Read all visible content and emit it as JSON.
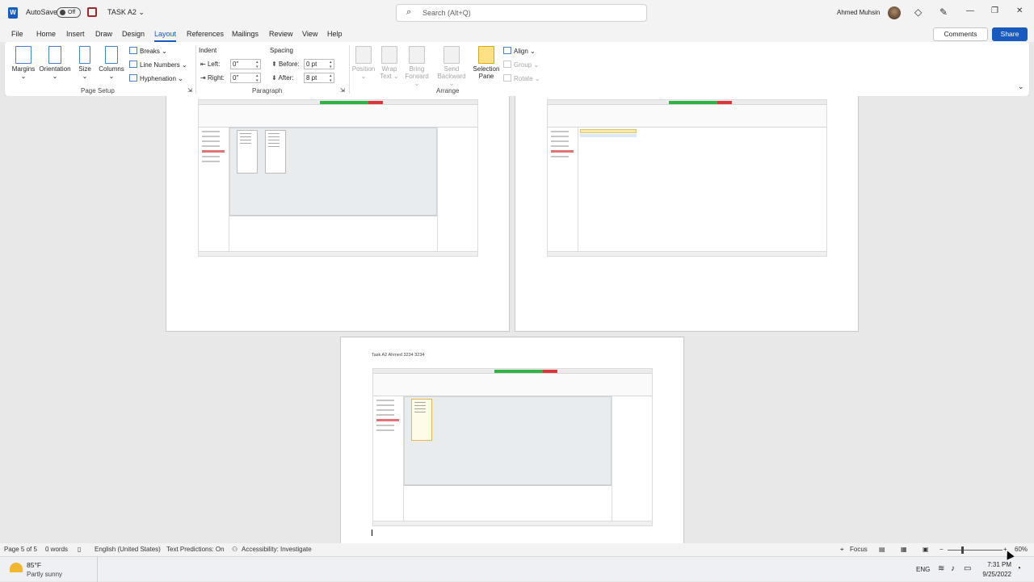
{
  "titlebar": {
    "app_logo": "W",
    "autosave_label": "AutoSave",
    "autosave_state": "Off",
    "doc_title": "TASK A2",
    "doc_title_chevron": "⌄",
    "search_placeholder": "Search (Alt+Q)",
    "user_name": "Ahmed Muhsin",
    "icons": [
      "diamond-icon",
      "pen-icon",
      "minimize-icon",
      "restore-icon",
      "close-icon"
    ],
    "glyphs": {
      "diamond": "◇",
      "pen": "✎",
      "minimize": "—",
      "restore": "❐",
      "close": "✕",
      "search": "⌕"
    }
  },
  "menu": {
    "tabs": [
      "File",
      "Home",
      "Insert",
      "Draw",
      "Design",
      "Layout",
      "References",
      "Mailings",
      "Review",
      "View",
      "Help"
    ],
    "active_tab": "Layout",
    "comments_label": "Comments",
    "share_label": "Share"
  },
  "ribbon": {
    "page_setup": {
      "margins": "Margins",
      "orientation": "Orientation",
      "size": "Size",
      "columns": "Columns",
      "breaks": "Breaks",
      "line_numbers": "Line Numbers",
      "hyphenation": "Hyphenation",
      "label": "Page Setup"
    },
    "paragraph": {
      "indent_title": "Indent",
      "left_label": "Left:",
      "left_value": "0\"",
      "right_label": "Right:",
      "right_value": "0\"",
      "spacing_title": "Spacing",
      "before_label": "Before:",
      "before_value": "0 pt",
      "after_label": "After:",
      "after_value": "8 pt",
      "label": "Paragraph"
    },
    "arrange": {
      "position": "Position",
      "wrap_text_1": "Wrap",
      "wrap_text_2": "Text",
      "bring_forward_1": "Bring",
      "bring_forward_2": "Forward",
      "send_backward_1": "Send",
      "send_backward_2": "Backward",
      "selection_pane_1": "Selection",
      "selection_pane_2": "Pane",
      "align": "Align",
      "group": "Group",
      "rotate": "Rotate",
      "label": "Arrange"
    }
  },
  "document": {
    "page3_caption": "Task A2 Ahmed 3234 3234"
  },
  "statusbar": {
    "page": "Page 5 of 5",
    "words": "0 words",
    "language": "English (United States)",
    "text_predictions": "Text Predictions: On",
    "accessibility": "Accessibility: Investigate",
    "focus": "Focus",
    "zoom_minus": "−",
    "zoom_plus": "+",
    "zoom": "60%",
    "zoom_fraction": 0.6
  },
  "taskbar": {
    "temp": "85°F",
    "weather": "Partly sunny",
    "lang": "ENG",
    "time": "7:31 PM",
    "date": "9/25/2022"
  }
}
